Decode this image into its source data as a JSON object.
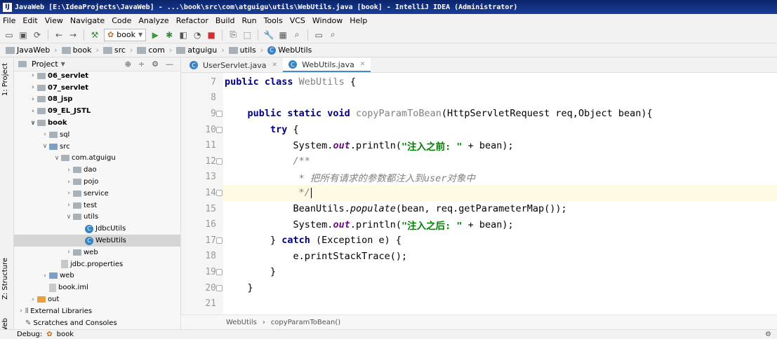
{
  "window": {
    "title": "JavaWeb [E:\\IdeaProjects\\JavaWeb] - ...\\book\\src\\com\\atguigu\\utils\\WebUtils.java [book] - IntelliJ IDEA (Administrator)"
  },
  "menu": [
    "File",
    "Edit",
    "View",
    "Navigate",
    "Code",
    "Analyze",
    "Refactor",
    "Build",
    "Run",
    "Tools",
    "VCS",
    "Window",
    "Help"
  ],
  "toolbar": {
    "run_config": "book"
  },
  "breadcrumbs": [
    "JavaWeb",
    "book",
    "src",
    "com",
    "atguigu",
    "utils",
    "WebUtils"
  ],
  "side_tabs": {
    "project": "1: Project",
    "structure": "Z: Structure",
    "web": "Web"
  },
  "project": {
    "header": "Project",
    "tree": [
      {
        "label": "06_servlet",
        "indent": 1,
        "expand": "closed",
        "icon": "folder",
        "bold": true
      },
      {
        "label": "07_servlet",
        "indent": 1,
        "expand": "closed",
        "icon": "folder",
        "bold": true
      },
      {
        "label": "08_jsp",
        "indent": 1,
        "expand": "closed",
        "icon": "folder",
        "bold": true
      },
      {
        "label": "09_EL_JSTL",
        "indent": 1,
        "expand": "closed",
        "icon": "folder",
        "bold": true
      },
      {
        "label": "book",
        "indent": 1,
        "expand": "open",
        "icon": "folder",
        "bold": true
      },
      {
        "label": "sql",
        "indent": 2,
        "expand": "closed",
        "icon": "folder",
        "bold": false
      },
      {
        "label": "src",
        "indent": 2,
        "expand": "open",
        "icon": "folder-blue",
        "bold": false
      },
      {
        "label": "com.atguigu",
        "indent": 3,
        "expand": "open",
        "icon": "folder",
        "bold": false
      },
      {
        "label": "dao",
        "indent": 4,
        "expand": "closed",
        "icon": "folder",
        "bold": false
      },
      {
        "label": "pojo",
        "indent": 4,
        "expand": "closed",
        "icon": "folder",
        "bold": false
      },
      {
        "label": "service",
        "indent": 4,
        "expand": "closed",
        "icon": "folder",
        "bold": false
      },
      {
        "label": "test",
        "indent": 4,
        "expand": "closed",
        "icon": "folder",
        "bold": false
      },
      {
        "label": "utils",
        "indent": 4,
        "expand": "open",
        "icon": "folder",
        "bold": false
      },
      {
        "label": "JdbcUtils",
        "indent": 5,
        "expand": "none",
        "icon": "class",
        "bold": false
      },
      {
        "label": "WebUtils",
        "indent": 5,
        "expand": "none",
        "icon": "class",
        "bold": false,
        "selected": true
      },
      {
        "label": "web",
        "indent": 4,
        "expand": "closed",
        "icon": "folder",
        "bold": false
      },
      {
        "label": "jdbc.properties",
        "indent": 3,
        "expand": "none",
        "icon": "file",
        "bold": false
      },
      {
        "label": "web",
        "indent": 2,
        "expand": "closed",
        "icon": "folder-blue",
        "bold": false
      },
      {
        "label": "book.iml",
        "indent": 2,
        "expand": "none",
        "icon": "file",
        "bold": false
      },
      {
        "label": "out",
        "indent": 1,
        "expand": "closed",
        "icon": "folder-orange",
        "bold": false
      },
      {
        "label": "External Libraries",
        "indent": 0,
        "expand": "closed",
        "icon": "libs",
        "bold": false
      },
      {
        "label": "Scratches and Consoles",
        "indent": 0,
        "expand": "none",
        "icon": "scratch",
        "bold": false
      }
    ]
  },
  "tabs": [
    {
      "label": "UserServlet.java",
      "active": false
    },
    {
      "label": "WebUtils.java",
      "active": true
    }
  ],
  "code": {
    "lines": [
      {
        "n": "7",
        "tokens": [
          {
            "t": "public class ",
            "c": "kw"
          },
          {
            "t": "WebUtils",
            "c": "cls"
          },
          {
            "t": " {",
            "c": ""
          }
        ]
      },
      {
        "n": "8",
        "tokens": []
      },
      {
        "n": "9",
        "tokens": [
          {
            "t": "    ",
            "c": ""
          },
          {
            "t": "public static void ",
            "c": "kw"
          },
          {
            "t": "copyParamToBean",
            "c": "cls"
          },
          {
            "t": "(HttpServletRequest req,Object bean){",
            "c": ""
          }
        ]
      },
      {
        "n": "10",
        "tokens": [
          {
            "t": "        ",
            "c": ""
          },
          {
            "t": "try",
            "c": "kw"
          },
          {
            "t": " {",
            "c": ""
          }
        ]
      },
      {
        "n": "11",
        "tokens": [
          {
            "t": "            System.",
            "c": ""
          },
          {
            "t": "out",
            "c": "fld"
          },
          {
            "t": ".println(",
            "c": ""
          },
          {
            "t": "\"注入之前: \"",
            "c": "str"
          },
          {
            "t": " + bean);",
            "c": ""
          }
        ]
      },
      {
        "n": "12",
        "tokens": [
          {
            "t": "            ",
            "c": ""
          },
          {
            "t": "/**",
            "c": "cmt"
          }
        ]
      },
      {
        "n": "13",
        "tokens": [
          {
            "t": "             * 把所有请求的参数都注入到user对象中",
            "c": "cmt"
          }
        ]
      },
      {
        "n": "14",
        "tokens": [
          {
            "t": "             */",
            "c": "cmt"
          }
        ],
        "current": true
      },
      {
        "n": "15",
        "tokens": [
          {
            "t": "            BeanUtils.",
            "c": ""
          },
          {
            "t": "populate",
            "c": "ital"
          },
          {
            "t": "(bean, req.getParameterMap());",
            "c": ""
          }
        ]
      },
      {
        "n": "16",
        "tokens": [
          {
            "t": "            System.",
            "c": ""
          },
          {
            "t": "out",
            "c": "fld"
          },
          {
            "t": ".println(",
            "c": ""
          },
          {
            "t": "\"注入之后: \"",
            "c": "str"
          },
          {
            "t": " + bean);",
            "c": ""
          }
        ]
      },
      {
        "n": "17",
        "tokens": [
          {
            "t": "        } ",
            "c": ""
          },
          {
            "t": "catch",
            "c": "kw"
          },
          {
            "t": " (Exception e) {",
            "c": ""
          }
        ]
      },
      {
        "n": "18",
        "tokens": [
          {
            "t": "            e.printStackTrace();",
            "c": ""
          }
        ]
      },
      {
        "n": "19",
        "tokens": [
          {
            "t": "        }",
            "c": ""
          }
        ]
      },
      {
        "n": "20",
        "tokens": [
          {
            "t": "    }",
            "c": ""
          }
        ]
      },
      {
        "n": "21",
        "tokens": []
      }
    ]
  },
  "editor_breadcrumb": [
    "WebUtils",
    "copyParamToBean()"
  ],
  "bottom": {
    "debug_label": "Debug:",
    "debug_config": "book"
  }
}
